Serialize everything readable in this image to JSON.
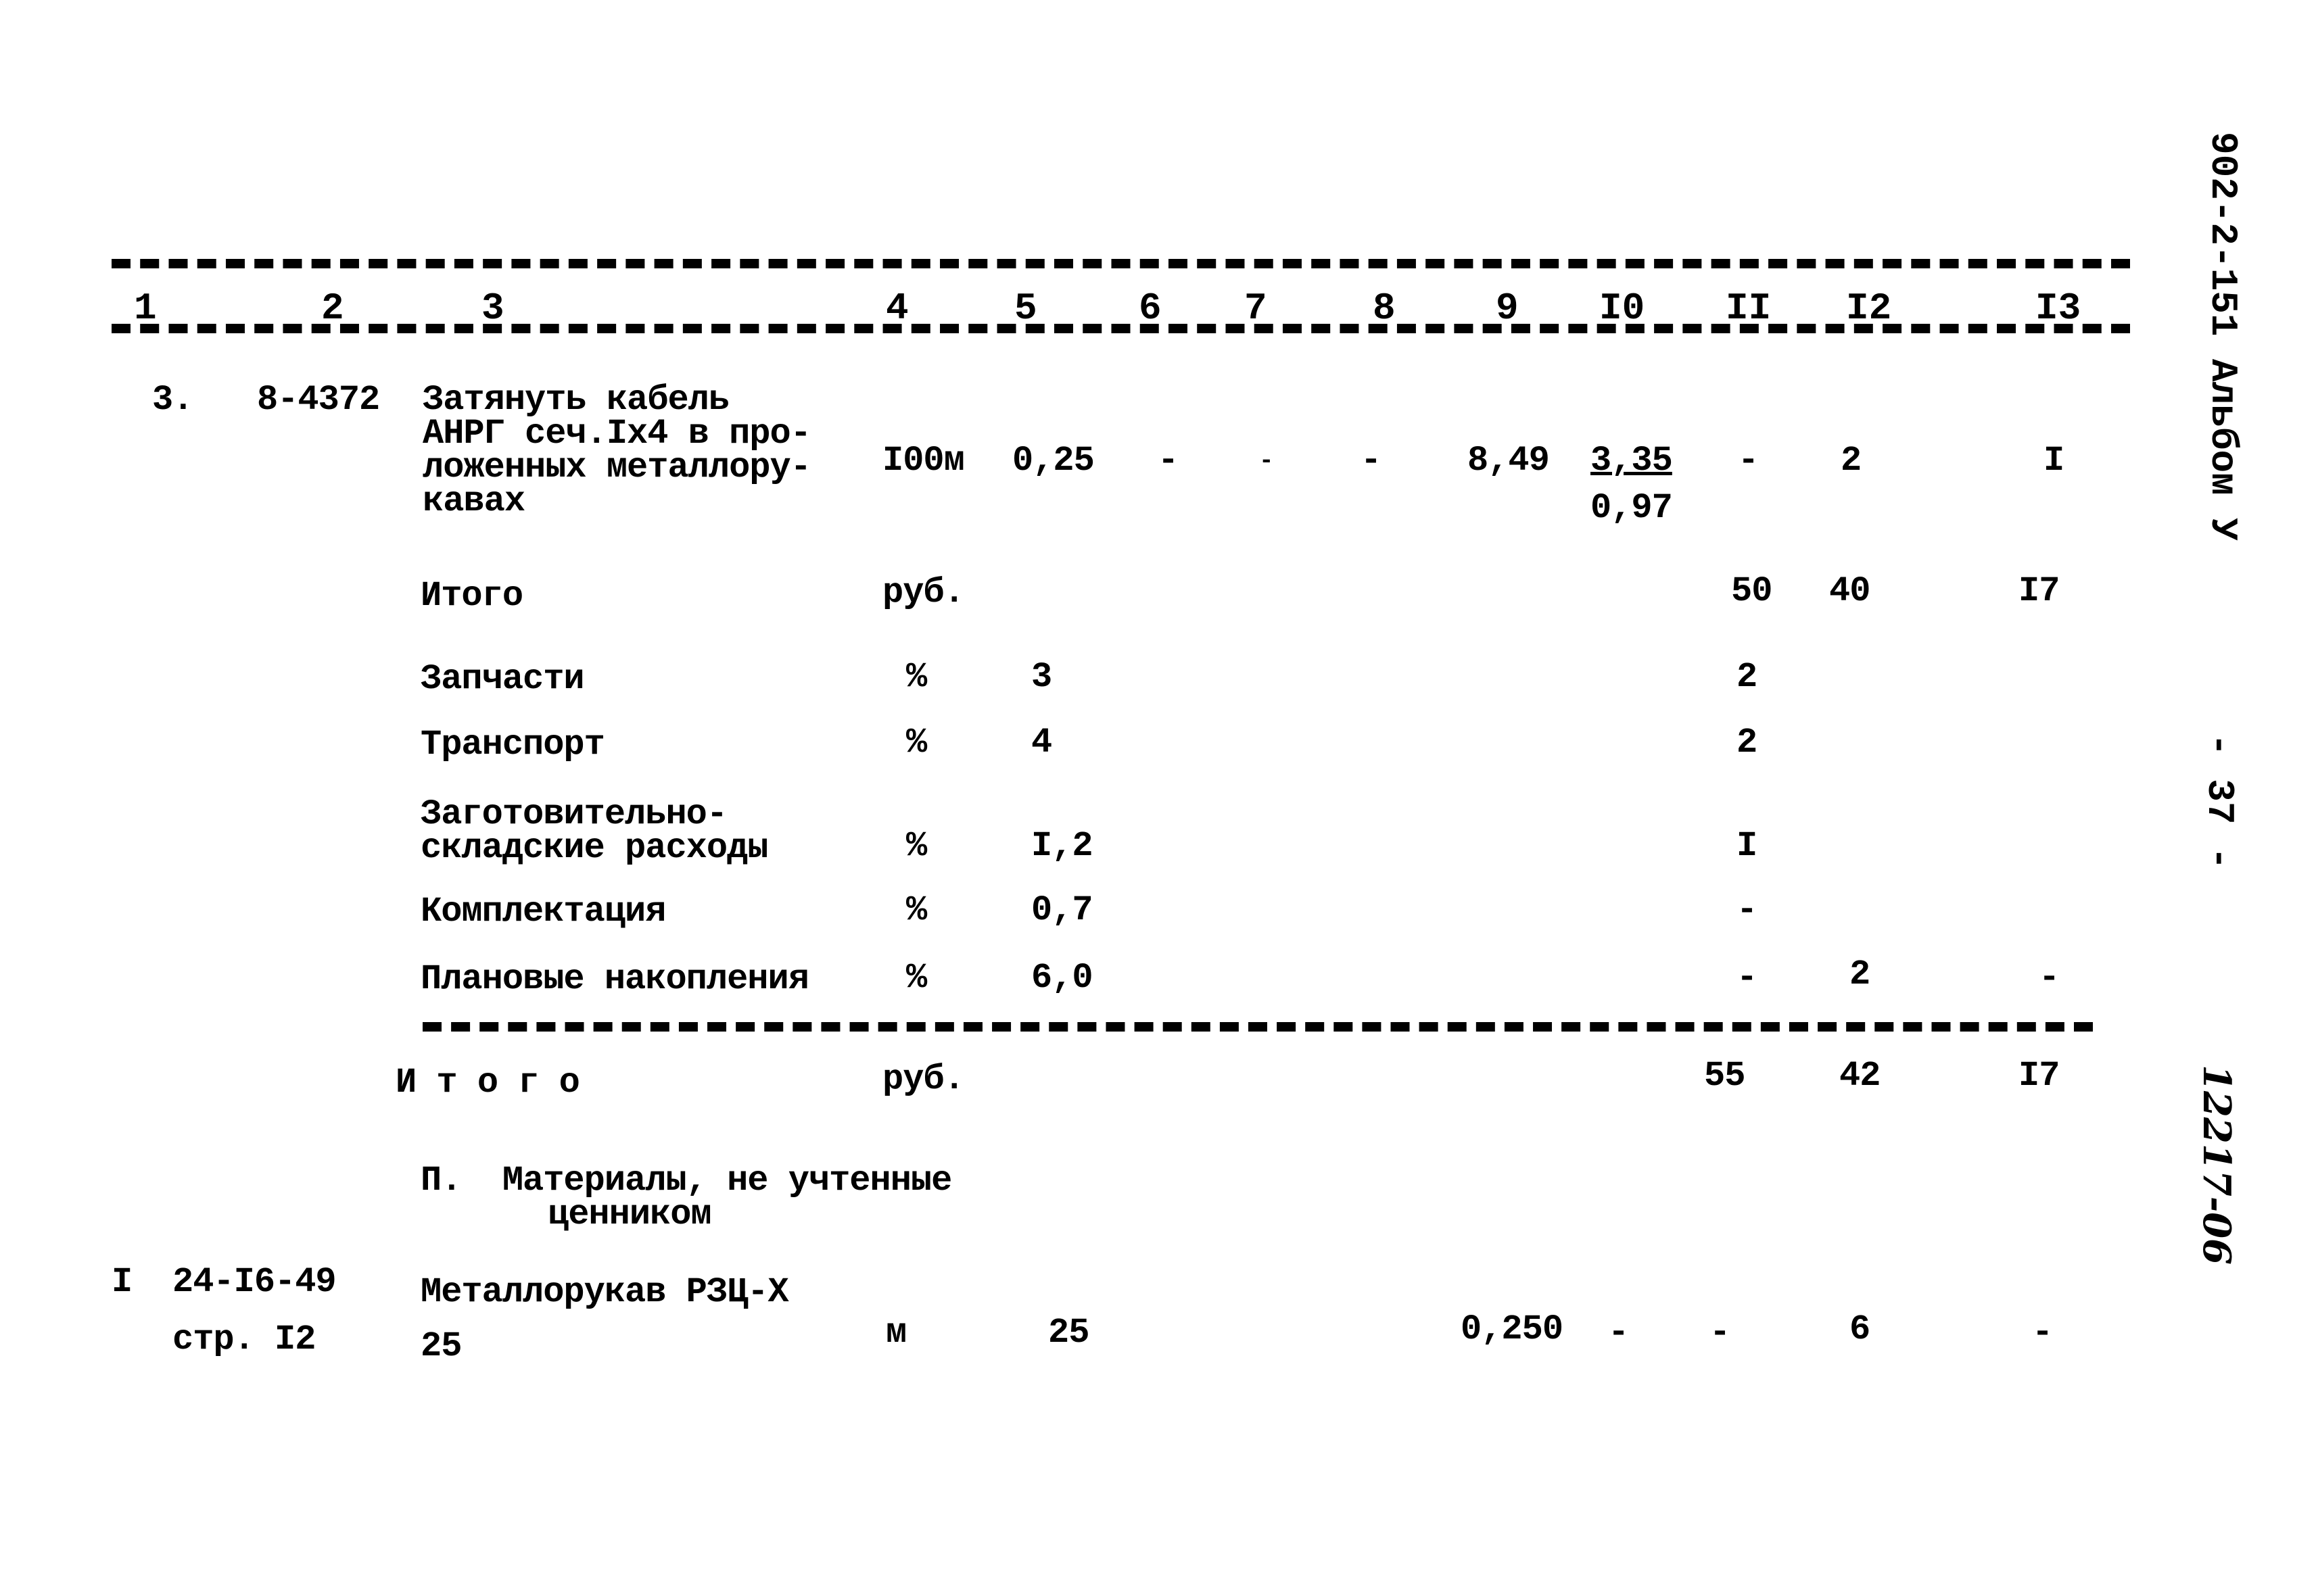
{
  "header": {
    "column_numbers": [
      "1",
      "2",
      "3",
      "4",
      "5",
      "6",
      "7",
      "8",
      "9",
      "I0",
      "II",
      "I2",
      "I3"
    ]
  },
  "side_labels": {
    "document_code": "902-2-151 Альбом У",
    "page_number": "- 37 -",
    "archive_number": "12217-06"
  },
  "item": {
    "number": "3.",
    "code": "8-4372",
    "description_lines": [
      "Затянуть кабель",
      "АНРГ сеч.Iх4 в про-",
      "ложенных металлору-",
      "кавах"
    ],
    "unit": "I00м",
    "col5": "0,25",
    "col6": "-",
    "col7": "-",
    "col8": "-",
    "col9": "8,49",
    "col10_top": "3,35",
    "col10_bottom": "0,97",
    "col11": "-",
    "col12": "2",
    "col13": "I"
  },
  "subtotal": {
    "label": "Итого",
    "unit": "руб.",
    "col11": "50",
    "col12": "40",
    "col13": "I7"
  },
  "surcharges": [
    {
      "label_lines": [
        "Запчасти"
      ],
      "unit": "%",
      "rate": "3",
      "col11": "2",
      "col12": "",
      "col13": ""
    },
    {
      "label_lines": [
        "Транспорт"
      ],
      "unit": "%",
      "rate": "4",
      "col11": "2",
      "col12": "",
      "col13": ""
    },
    {
      "label_lines": [
        "Заготовительно-",
        "складские расходы"
      ],
      "unit": "%",
      "rate": "I,2",
      "col11": "I",
      "col12": "",
      "col13": ""
    },
    {
      "label_lines": [
        "Комплектация"
      ],
      "unit": "%",
      "rate": "0,7",
      "col11": "-",
      "col12": "",
      "col13": ""
    },
    {
      "label_lines": [
        "Плановые накопления"
      ],
      "unit": "%",
      "rate": "6,0",
      "col11": "-",
      "col12": "2",
      "col13": "-"
    }
  ],
  "total": {
    "label": "И т о г о",
    "unit": "руб.",
    "col11": "55",
    "col12": "42",
    "col13": "I7"
  },
  "section2": {
    "title_line1": "П.  Материалы, не учтенные",
    "title_line2": "ценником"
  },
  "material": {
    "number": "I",
    "code_line1": "24-I6-49",
    "code_line2": "стр. I2",
    "name_line1": "Металлорукав РЗЦ-Х",
    "name_line2": "25",
    "unit": "м",
    "qty": "25",
    "col9": "0,250",
    "col10": "-",
    "col11": "-",
    "col12": "6",
    "col13": "-"
  }
}
